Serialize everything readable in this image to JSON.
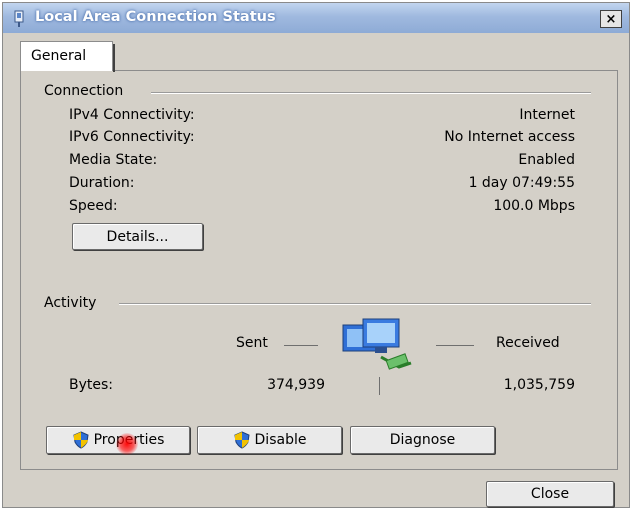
{
  "window": {
    "title": "Local Area Connection Status",
    "close_glyph": "×"
  },
  "tabs": [
    {
      "label": "General",
      "selected": true
    }
  ],
  "connection": {
    "heading": "Connection",
    "rows": [
      {
        "label": "IPv4 Connectivity:",
        "value": "Internet"
      },
      {
        "label": "IPv6 Connectivity:",
        "value": "No Internet access"
      },
      {
        "label": "Media State:",
        "value": "Enabled"
      },
      {
        "label": "Duration:",
        "value": "1 day 07:49:55"
      },
      {
        "label": "Speed:",
        "value": "100.0 Mbps"
      }
    ],
    "details_button": "Details..."
  },
  "activity": {
    "heading": "Activity",
    "sent_label": "Sent",
    "received_label": "Received",
    "bytes_label": "Bytes:",
    "bytes_sent": "374,939",
    "bytes_received": "1,035,759",
    "icon": "network-computers-icon"
  },
  "buttons": {
    "properties": "Properties",
    "disable": "Disable",
    "diagnose": "Diagnose",
    "close": "Close"
  },
  "colors": {
    "titlebar": "#9fb9df",
    "face": "#d4d0c8",
    "shield_blue": "#2f6fd6",
    "shield_yellow": "#f2c200"
  }
}
